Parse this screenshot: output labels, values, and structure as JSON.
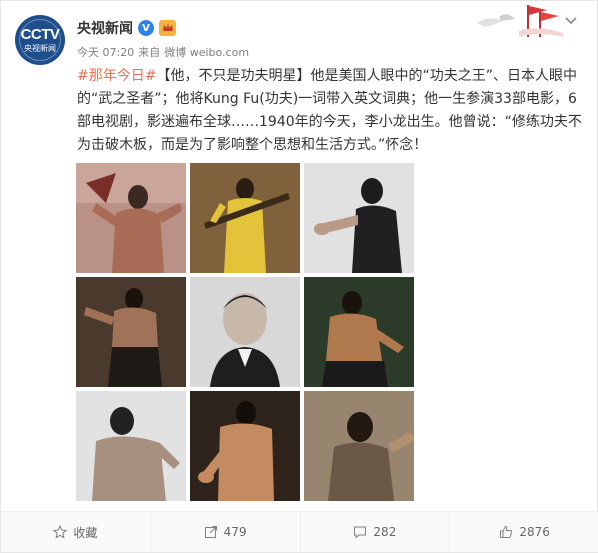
{
  "account": {
    "avatar_logo": "CCTV",
    "avatar_subtitle": "央视新闻",
    "name": "央视新闻",
    "verified_icon": "verified-v-icon",
    "badge_icon": "member-badge-icon"
  },
  "meta": {
    "time": "今天 07:20",
    "from": "来自",
    "source": "微博 weibo.com"
  },
  "post": {
    "topic": "#那年今日#",
    "segment1": "【他，不只是功夫明星】他是美国人眼中的“功夫之王”、日本人眼中的“武之圣者”；他将Kung Fu(功夫)一词带入英文词典；他一生参演33部电影，6部电视剧，影迷遍布全球……1940年的今天，李小龙出生。他曾说：“修练功夫不为击破木板，而是为了影响整个思想和生活方式。”怀念！"
  },
  "photos": [
    {
      "label": "photo-1"
    },
    {
      "label": "photo-2"
    },
    {
      "label": "photo-3"
    },
    {
      "label": "photo-4"
    },
    {
      "label": "photo-5"
    },
    {
      "label": "photo-6"
    },
    {
      "label": "photo-7"
    },
    {
      "label": "photo-8"
    },
    {
      "label": "photo-9"
    }
  ],
  "actions": {
    "favorite_label": "收藏",
    "repost_count": "479",
    "comment_count": "282",
    "like_count": "2876"
  },
  "colors": {
    "link": "#eb7350",
    "verified": "#2b84e6",
    "footer_bg": "#fafafa"
  }
}
